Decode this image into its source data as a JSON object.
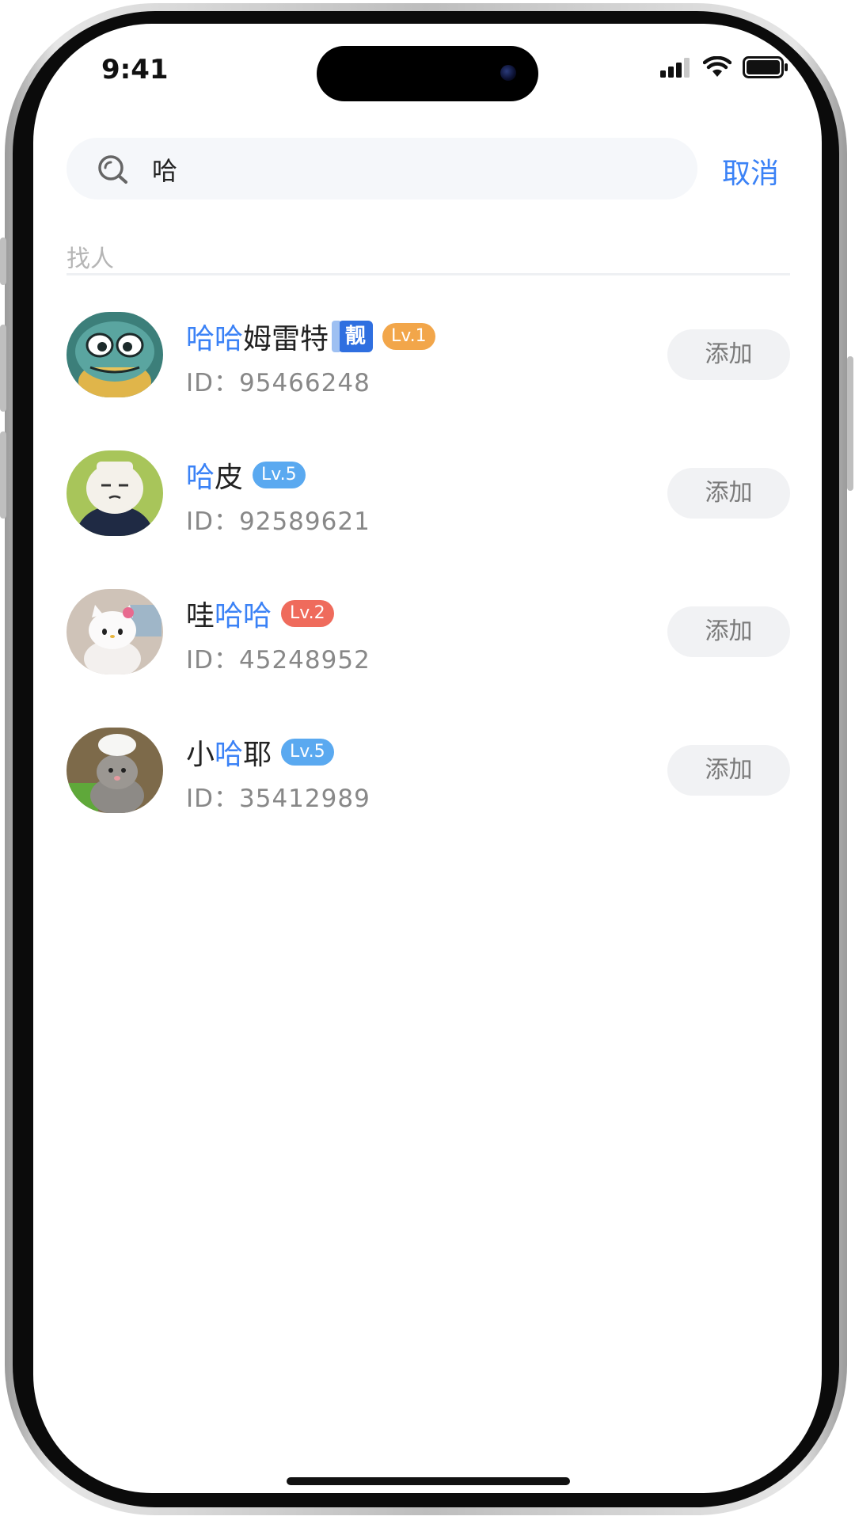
{
  "status_bar": {
    "time": "9:41"
  },
  "search": {
    "value": "哈",
    "placeholder": "",
    "cancel_label": "取消"
  },
  "section": {
    "label": "找人"
  },
  "results": [
    {
      "name_parts": [
        {
          "text": "哈哈",
          "highlight": true
        },
        {
          "text": "姆雷特",
          "highlight": false
        }
      ],
      "pretty_badge": "靓",
      "level": "Lv.1",
      "level_color": "#f2a64a",
      "id_text": "ID：95466248",
      "avatar_icon": "cartoon-bird-avatar",
      "add_label": "添加"
    },
    {
      "name_parts": [
        {
          "text": "哈",
          "highlight": true
        },
        {
          "text": "皮",
          "highlight": false
        }
      ],
      "level": "Lv.5",
      "level_color": "#5aa9f0",
      "id_text": "ID：92589621",
      "avatar_icon": "sleepy-character-avatar",
      "add_label": "添加"
    },
    {
      "name_parts": [
        {
          "text": "哇",
          "highlight": false
        },
        {
          "text": "哈哈",
          "highlight": true
        }
      ],
      "level": "Lv.2",
      "level_color": "#ef6b5c",
      "id_text": "ID：45248952",
      "avatar_icon": "hello-kitty-avatar",
      "add_label": "添加"
    },
    {
      "name_parts": [
        {
          "text": "小",
          "highlight": false
        },
        {
          "text": "哈",
          "highlight": true
        },
        {
          "text": "耶",
          "highlight": false
        }
      ],
      "level": "Lv.5",
      "level_color": "#5aa9f0",
      "id_text": "ID：35412989",
      "avatar_icon": "chef-mouse-avatar",
      "add_label": "添加"
    }
  ],
  "colors": {
    "accent": "#3b82f6",
    "muted": "#888888",
    "button_bg": "#f1f2f4"
  }
}
